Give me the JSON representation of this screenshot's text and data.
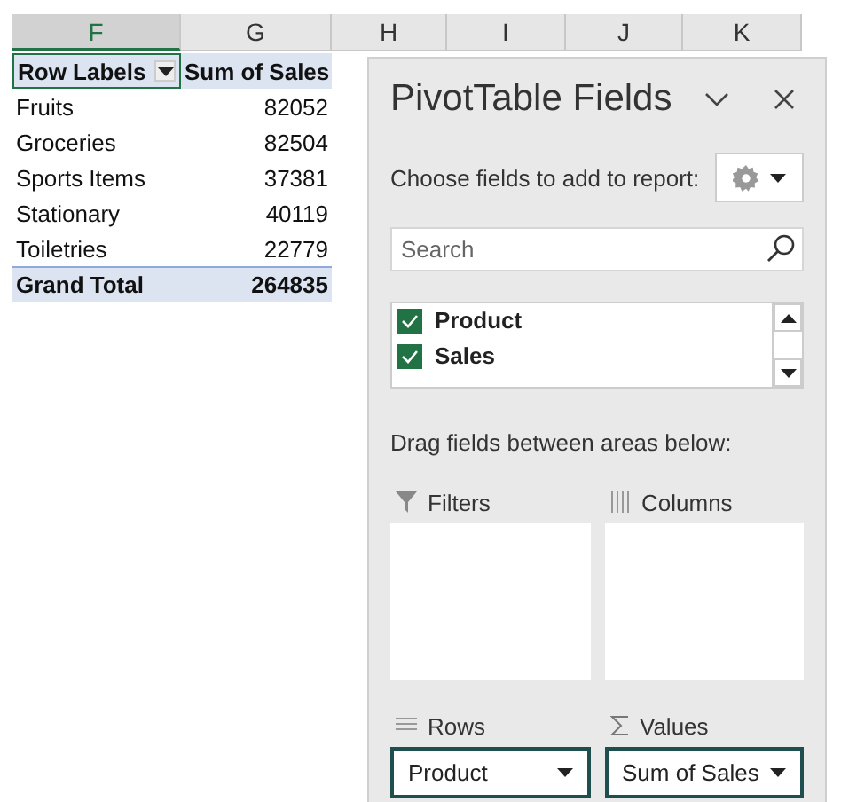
{
  "column_headers": [
    {
      "label": "F",
      "selected": true
    },
    {
      "label": "G",
      "selected": false
    },
    {
      "label": "H",
      "selected": false
    },
    {
      "label": "I",
      "selected": false
    },
    {
      "label": "J",
      "selected": false
    },
    {
      "label": "K",
      "selected": false
    }
  ],
  "pivot": {
    "headers": [
      "Row Labels",
      "Sum of Sales"
    ],
    "rows": [
      {
        "label": "Fruits",
        "value": "82052"
      },
      {
        "label": "Groceries",
        "value": "82504"
      },
      {
        "label": "Sports Items",
        "value": "37381"
      },
      {
        "label": "Stationary",
        "value": "40119"
      },
      {
        "label": "Toiletries",
        "value": "22779"
      }
    ],
    "total": {
      "label": "Grand Total",
      "value": "264835"
    }
  },
  "panel": {
    "title": "PivotTable Fields",
    "subtitle": "Choose fields to add to report:",
    "search": {
      "placeholder": "Search"
    },
    "fields": [
      {
        "name": "Product",
        "checked": true
      },
      {
        "name": "Sales",
        "checked": true
      }
    ],
    "areas_hint": "Drag fields between areas below:",
    "areas": [
      {
        "kind": "filters",
        "label": "Filters"
      },
      {
        "kind": "columns",
        "label": "Columns"
      },
      {
        "kind": "rows",
        "label": "Rows",
        "field": "Product"
      },
      {
        "kind": "values",
        "label": "Values",
        "field": "Sum of Sales"
      }
    ]
  }
}
